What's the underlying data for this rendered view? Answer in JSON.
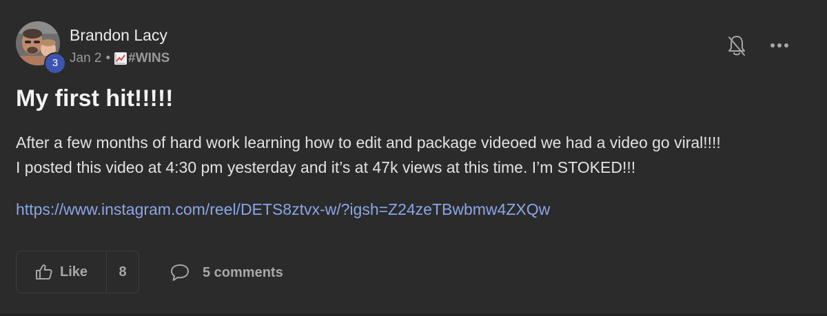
{
  "post": {
    "author": {
      "name": "Brandon Lacy",
      "level": "3"
    },
    "meta": {
      "date": "Jan 2",
      "separator": "•",
      "category": "#WINS",
      "category_icon": "chart-increasing-icon"
    },
    "title": "My first hit!!!!!",
    "body": [
      "After a few months of hard work learning how to edit and package videoed we had a video go viral!!!!",
      "I posted this video at 4:30 pm yesterday and it’s at 47k views at this time. I’m STOKED!!!"
    ],
    "link": "https://www.instagram.com/reel/DETS8ztvx-w/?igsh=Z24zeTBwbmw4ZXQw",
    "actions": {
      "like_label": "Like",
      "like_count": "8",
      "comments_label": "5 comments"
    }
  },
  "colors": {
    "background": "#2b2b2b",
    "link": "#8aa6e8",
    "badge": "#3d55b0",
    "muted_text": "#9a9a9a"
  }
}
